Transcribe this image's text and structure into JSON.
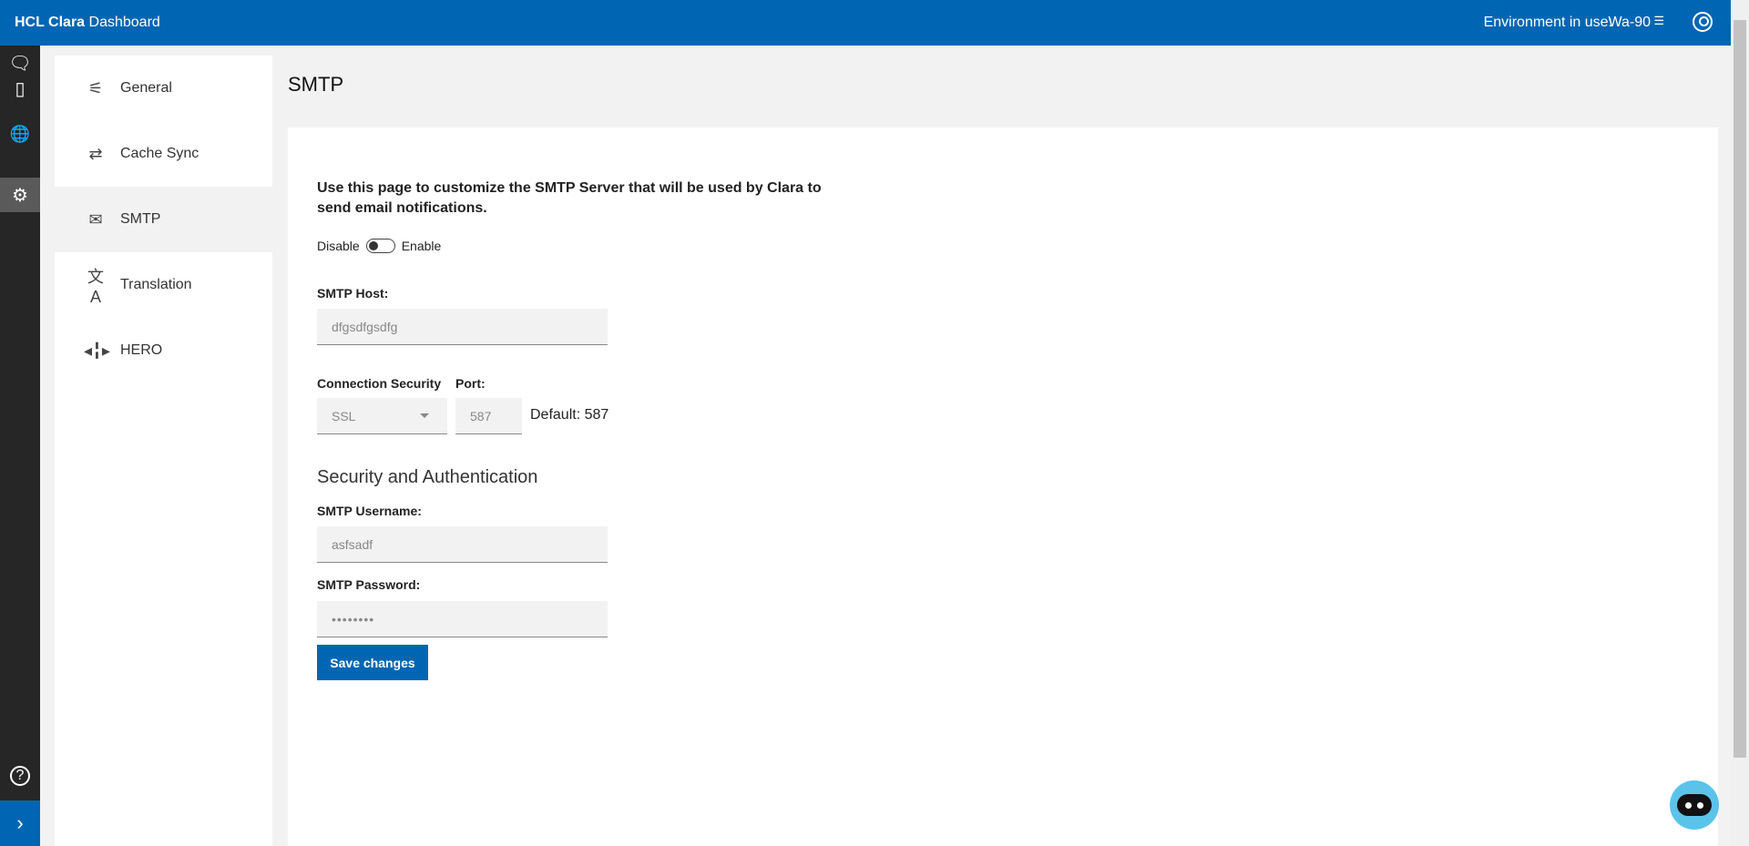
{
  "header": {
    "brand_bold": "HCL Clara",
    "brand_rest": "Dashboard",
    "env_label": "Environment in use:",
    "env_value": "Wa-90",
    "env_icon": "server-icon",
    "user_icon": "user-circle-icon"
  },
  "rail": {
    "icons": [
      "chat-icon",
      "contact-card-icon",
      "globe-settings-icon",
      "gear-icon"
    ],
    "help_icon": "help-icon",
    "expand_icon": "chevron-right-icon"
  },
  "nav": {
    "items": [
      {
        "label": "General",
        "icon": "sliders-icon"
      },
      {
        "label": "Cache Sync",
        "icon": "sync-arrows-icon"
      },
      {
        "label": "SMTP",
        "icon": "mail-forward-icon",
        "selected": true
      },
      {
        "label": "Translation",
        "icon": "translate-icon"
      },
      {
        "label": "HERO",
        "icon": "hero-icon"
      }
    ]
  },
  "page": {
    "title": "SMTP",
    "description": "Use this page to customize the SMTP Server that will be used by Clara to send email notifications.",
    "toggle": {
      "off_label": "Disable",
      "on_label": "Enable",
      "enabled": false
    },
    "host": {
      "label": "SMTP Host:",
      "value": "dfgsdfgsdfg"
    },
    "security": {
      "label": "Connection Security",
      "value": "SSL"
    },
    "port": {
      "label": "Port:",
      "value": "587",
      "default_text": "Default: 587"
    },
    "auth_heading": "Security and Authentication",
    "username": {
      "label": "SMTP Username:",
      "value": "asfsadf"
    },
    "password": {
      "label": "SMTP Password:",
      "value": "••••••••"
    },
    "save_label": "Save changes"
  },
  "colors": {
    "brand": "#0066b3",
    "rail": "#262626"
  }
}
